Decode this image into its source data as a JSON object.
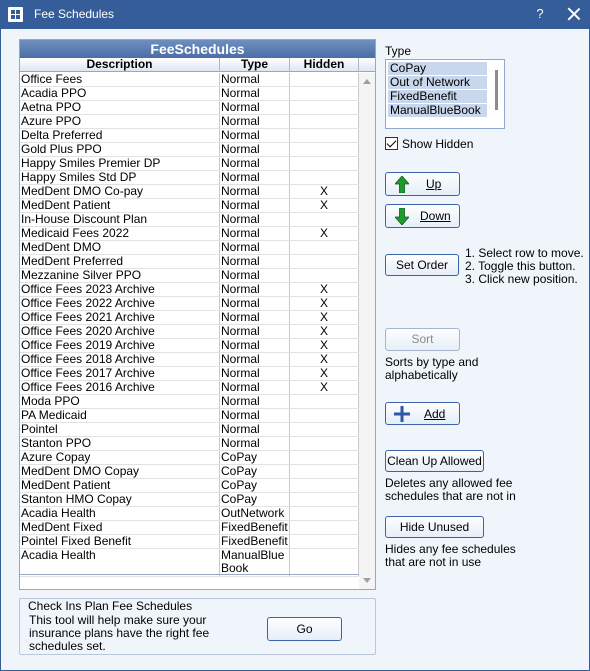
{
  "window": {
    "title": "Fee Schedules",
    "help_label": "?"
  },
  "grid": {
    "title": "FeeSchedules",
    "columns": [
      "Description",
      "Type",
      "Hidden"
    ],
    "rows": [
      {
        "description": "Office Fees",
        "type": "Normal",
        "hidden": ""
      },
      {
        "description": "Acadia PPO",
        "type": "Normal",
        "hidden": ""
      },
      {
        "description": "Aetna PPO",
        "type": "Normal",
        "hidden": ""
      },
      {
        "description": "Azure PPO",
        "type": "Normal",
        "hidden": ""
      },
      {
        "description": "Delta Preferred",
        "type": "Normal",
        "hidden": ""
      },
      {
        "description": "Gold Plus PPO",
        "type": "Normal",
        "hidden": ""
      },
      {
        "description": "Happy Smiles Premier DP",
        "type": "Normal",
        "hidden": ""
      },
      {
        "description": "Happy Smiles Std DP",
        "type": "Normal",
        "hidden": ""
      },
      {
        "description": "MedDent DMO Co-pay",
        "type": "Normal",
        "hidden": "X"
      },
      {
        "description": "MedDent Patient",
        "type": "Normal",
        "hidden": "X"
      },
      {
        "description": "In-House Discount Plan",
        "type": "Normal",
        "hidden": ""
      },
      {
        "description": "Medicaid Fees 2022",
        "type": "Normal",
        "hidden": "X"
      },
      {
        "description": "MedDent DMO",
        "type": "Normal",
        "hidden": ""
      },
      {
        "description": "MedDent Preferred",
        "type": "Normal",
        "hidden": ""
      },
      {
        "description": "Mezzanine Silver PPO",
        "type": "Normal",
        "hidden": ""
      },
      {
        "description": "Office Fees 2023 Archive",
        "type": "Normal",
        "hidden": "X"
      },
      {
        "description": "Office Fees 2022 Archive",
        "type": "Normal",
        "hidden": "X"
      },
      {
        "description": "Office Fees 2021 Archive",
        "type": "Normal",
        "hidden": "X"
      },
      {
        "description": "Office Fees 2020 Archive",
        "type": "Normal",
        "hidden": "X"
      },
      {
        "description": "Office Fees 2019 Archive",
        "type": "Normal",
        "hidden": "X"
      },
      {
        "description": "Office Fees 2018 Archive",
        "type": "Normal",
        "hidden": "X"
      },
      {
        "description": "Office Fees 2017 Archive",
        "type": "Normal",
        "hidden": "X"
      },
      {
        "description": "Office Fees 2016 Archive",
        "type": "Normal",
        "hidden": "X"
      },
      {
        "description": "Moda PPO",
        "type": "Normal",
        "hidden": ""
      },
      {
        "description": "PA Medicaid",
        "type": "Normal",
        "hidden": ""
      },
      {
        "description": "Pointel",
        "type": "Normal",
        "hidden": ""
      },
      {
        "description": "Stanton PPO",
        "type": "Normal",
        "hidden": ""
      },
      {
        "description": "Azure Copay",
        "type": "CoPay",
        "hidden": ""
      },
      {
        "description": "MedDent DMO Copay",
        "type": "CoPay",
        "hidden": ""
      },
      {
        "description": "MedDent Patient",
        "type": "CoPay",
        "hidden": ""
      },
      {
        "description": "Stanton HMO Copay",
        "type": "CoPay",
        "hidden": ""
      },
      {
        "description": "Acadia Health",
        "type": "OutNetwork",
        "hidden": ""
      },
      {
        "description": "MedDent Fixed",
        "type": "FixedBenefit",
        "hidden": ""
      },
      {
        "description": "Pointel Fixed Benefit",
        "type": "FixedBenefit",
        "hidden": ""
      },
      {
        "description": "Acadia Health",
        "type": "ManualBlue Book",
        "hidden": ""
      }
    ]
  },
  "check_ins": {
    "title": "Check Ins Plan Fee Schedules",
    "text": "This tool will help make sure your insurance plans have the right fee schedules set.",
    "go_label": "Go"
  },
  "type_filter": {
    "label": "Type",
    "options": [
      "CoPay",
      "Out of Network",
      "FixedBenefit",
      "ManualBlueBook"
    ]
  },
  "show_hidden": {
    "label": "Show Hidden",
    "checked": true
  },
  "buttons": {
    "up": "Up",
    "down": "Down",
    "set_order": "Set Order",
    "sort": "Sort",
    "add": "Add",
    "clean_up": "Clean Up Allowed",
    "hide_unused": "Hide Unused"
  },
  "help_text": {
    "set_order_steps": [
      "1. Select row to move.",
      "2. Toggle this button.",
      "3. Click new position."
    ],
    "sort": "Sorts by type and alphabetically",
    "clean_up": "Deletes any allowed fee schedules that are not in",
    "hide_unused": "Hides any fee schedules that are not in use"
  },
  "colors": {
    "titlebar": "#355d99",
    "arrow_green": "#1f9a2f",
    "add_blue": "#2f55a4"
  }
}
